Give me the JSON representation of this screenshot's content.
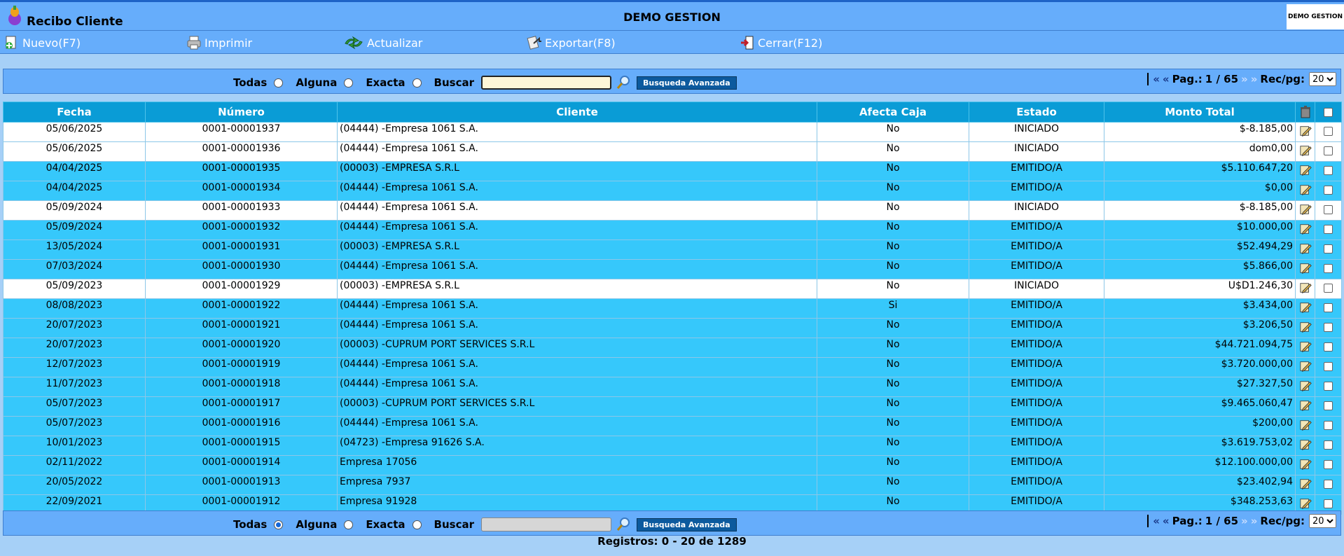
{
  "header": {
    "app_title": "Recibo Cliente",
    "center_title": "DEMO GESTION",
    "corner_logo_text": "DEMO GESTION"
  },
  "toolbar": {
    "nuevo": "Nuevo(F7)",
    "imprimir": "Imprimir",
    "actualizar": "Actualizar",
    "exportar": "Exportar(F8)",
    "cerrar": "Cerrar(F12)"
  },
  "search": {
    "todas": "Todas",
    "alguna": "Alguna",
    "exacta": "Exacta",
    "buscar": "Buscar",
    "advanced": "Busqueda Avanzada",
    "selected_bottom": "Alguna"
  },
  "pager": {
    "label": "Pag.:",
    "page": "1 / 65",
    "rec_label": "Rec/pg:",
    "rec_value": "20",
    "first": "«",
    "prev": "«",
    "next": "»",
    "last": "»"
  },
  "table": {
    "headers": {
      "fecha": "Fecha",
      "numero": "Número",
      "cliente": "Cliente",
      "afecta": "Afecta Caja",
      "estado": "Estado",
      "monto": "Monto Total"
    },
    "rows": [
      {
        "fecha": "05/06/2025",
        "numero": "0001-00001937",
        "cliente": "(04444) -Empresa 1061 S.A.",
        "afecta": "No",
        "estado": "INICIADO",
        "monto": "$-8.185,00"
      },
      {
        "fecha": "05/06/2025",
        "numero": "0001-00001936",
        "cliente": "(04444) -Empresa 1061 S.A.",
        "afecta": "No",
        "estado": "INICIADO",
        "monto": "dom0,00"
      },
      {
        "fecha": "04/04/2025",
        "numero": "0001-00001935",
        "cliente": "(00003) -EMPRESA S.R.L",
        "afecta": "No",
        "estado": "EMITIDO/A",
        "monto": "$5.110.647,20"
      },
      {
        "fecha": "04/04/2025",
        "numero": "0001-00001934",
        "cliente": "(04444) -Empresa 1061 S.A.",
        "afecta": "No",
        "estado": "EMITIDO/A",
        "monto": "$0,00"
      },
      {
        "fecha": "05/09/2024",
        "numero": "0001-00001933",
        "cliente": "(04444) -Empresa 1061 S.A.",
        "afecta": "No",
        "estado": "INICIADO",
        "monto": "$-8.185,00"
      },
      {
        "fecha": "05/09/2024",
        "numero": "0001-00001932",
        "cliente": "(04444) -Empresa 1061 S.A.",
        "afecta": "No",
        "estado": "EMITIDO/A",
        "monto": "$10.000,00"
      },
      {
        "fecha": "13/05/2024",
        "numero": "0001-00001931",
        "cliente": "(00003) -EMPRESA S.R.L",
        "afecta": "No",
        "estado": "EMITIDO/A",
        "monto": "$52.494,29"
      },
      {
        "fecha": "07/03/2024",
        "numero": "0001-00001930",
        "cliente": "(04444) -Empresa 1061 S.A.",
        "afecta": "No",
        "estado": "EMITIDO/A",
        "monto": "$5.866,00"
      },
      {
        "fecha": "05/09/2023",
        "numero": "0001-00001929",
        "cliente": "(00003) -EMPRESA S.R.L",
        "afecta": "No",
        "estado": "INICIADO",
        "monto": "U$D1.246,30"
      },
      {
        "fecha": "08/08/2023",
        "numero": "0001-00001922",
        "cliente": "(04444) -Empresa 1061 S.A.",
        "afecta": "Si",
        "estado": "EMITIDO/A",
        "monto": "$3.434,00"
      },
      {
        "fecha": "20/07/2023",
        "numero": "0001-00001921",
        "cliente": "(04444) -Empresa 1061 S.A.",
        "afecta": "No",
        "estado": "EMITIDO/A",
        "monto": "$3.206,50"
      },
      {
        "fecha": "20/07/2023",
        "numero": "0001-00001920",
        "cliente": "(00003) -CUPRUM PORT SERVICES S.R.L",
        "afecta": "No",
        "estado": "EMITIDO/A",
        "monto": "$44.721.094,75"
      },
      {
        "fecha": "12/07/2023",
        "numero": "0001-00001919",
        "cliente": "(04444) -Empresa 1061 S.A.",
        "afecta": "No",
        "estado": "EMITIDO/A",
        "monto": "$3.720.000,00"
      },
      {
        "fecha": "11/07/2023",
        "numero": "0001-00001918",
        "cliente": "(04444) -Empresa 1061 S.A.",
        "afecta": "No",
        "estado": "EMITIDO/A",
        "monto": "$27.327,50"
      },
      {
        "fecha": "05/07/2023",
        "numero": "0001-00001917",
        "cliente": "(00003) -CUPRUM PORT SERVICES S.R.L",
        "afecta": "No",
        "estado": "EMITIDO/A",
        "monto": "$9.465.060,47"
      },
      {
        "fecha": "05/07/2023",
        "numero": "0001-00001916",
        "cliente": "(04444) -Empresa 1061 S.A.",
        "afecta": "No",
        "estado": "EMITIDO/A",
        "monto": "$200,00"
      },
      {
        "fecha": "10/01/2023",
        "numero": "0001-00001915",
        "cliente": "(04723) -Empresa 91626 S.A.",
        "afecta": "No",
        "estado": "EMITIDO/A",
        "monto": "$3.619.753,02"
      },
      {
        "fecha": "02/11/2022",
        "numero": "0001-00001914",
        "cliente": "Empresa 17056",
        "afecta": "No",
        "estado": "EMITIDO/A",
        "monto": "$12.100.000,00"
      },
      {
        "fecha": "20/05/2022",
        "numero": "0001-00001913",
        "cliente": "Empresa 7937",
        "afecta": "No",
        "estado": "EMITIDO/A",
        "monto": "$23.402,94"
      },
      {
        "fecha": "22/09/2021",
        "numero": "0001-00001912",
        "cliente": "Empresa 91928",
        "afecta": "No",
        "estado": "EMITIDO/A",
        "monto": "$348.253,63"
      }
    ]
  },
  "footer": {
    "registros": "Registros: 0 - 20 de 1289"
  },
  "colors": {
    "row_blue": "#36c8fb",
    "header_blue": "#0a9cd6",
    "bar_blue": "#66adfb"
  }
}
